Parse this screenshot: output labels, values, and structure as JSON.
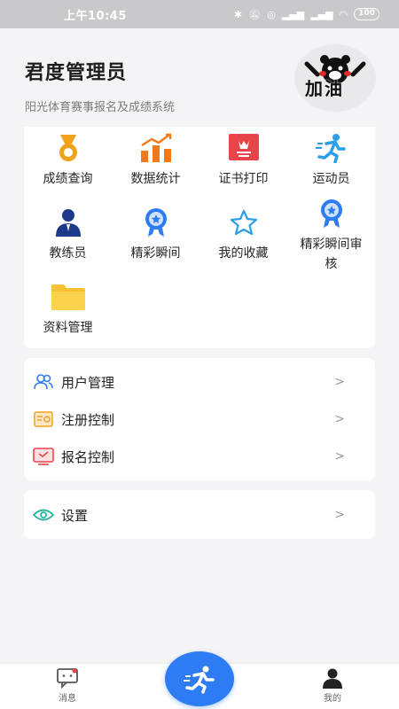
{
  "status_bar": {
    "time": "上午10:45",
    "battery": "100"
  },
  "header": {
    "user_name": "君度管理员",
    "subtitle": "阳光体育赛事报名及成绩系统",
    "avatar_text": "加油"
  },
  "grid": {
    "items": [
      {
        "label": "成绩查询",
        "icon": "medal-icon"
      },
      {
        "label": "数据统计",
        "icon": "bar-chart-icon"
      },
      {
        "label": "证书打印",
        "icon": "certificate-icon"
      },
      {
        "label": "运动员",
        "icon": "runner-icon"
      },
      {
        "label": "教练员",
        "icon": "coach-icon"
      },
      {
        "label": "精彩瞬间",
        "icon": "award-badge-icon"
      },
      {
        "label": "我的收藏",
        "icon": "star-icon"
      },
      {
        "label": "精彩瞬间审核",
        "icon": "award-badge-icon"
      },
      {
        "label": "资料管理",
        "icon": "folder-icon"
      }
    ]
  },
  "menu": {
    "items": [
      {
        "label": "用户管理",
        "icon": "users-icon"
      },
      {
        "label": "注册控制",
        "icon": "id-card-icon"
      },
      {
        "label": "报名控制",
        "icon": "monitor-icon"
      }
    ],
    "chevron": ">"
  },
  "settings": {
    "label": "设置",
    "icon": "eye-icon",
    "chevron": ">"
  },
  "tab_bar": {
    "messages": "消息",
    "mine": "我的"
  },
  "colors": {
    "accent": "#2d7cf3",
    "orange": "#f08a1c",
    "red": "#e8454b",
    "background": "#f4f4f6"
  }
}
